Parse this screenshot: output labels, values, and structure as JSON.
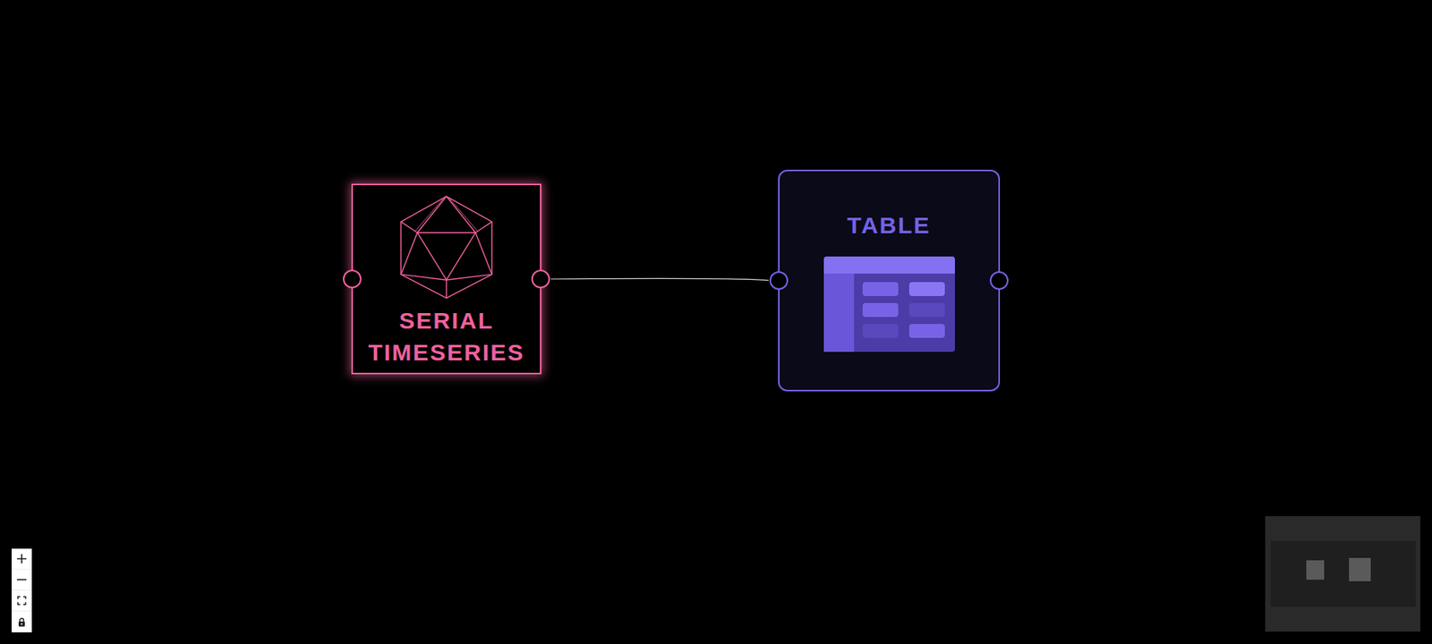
{
  "nodes": [
    {
      "label": "SERIAL TIMESERIES",
      "kind": "source",
      "color": "#f0619e",
      "selected": true
    },
    {
      "label": "TABLE",
      "kind": "table",
      "color": "#7462e6",
      "selected": false
    }
  ],
  "edges": [
    {
      "from": 0,
      "to": 1
    }
  ]
}
